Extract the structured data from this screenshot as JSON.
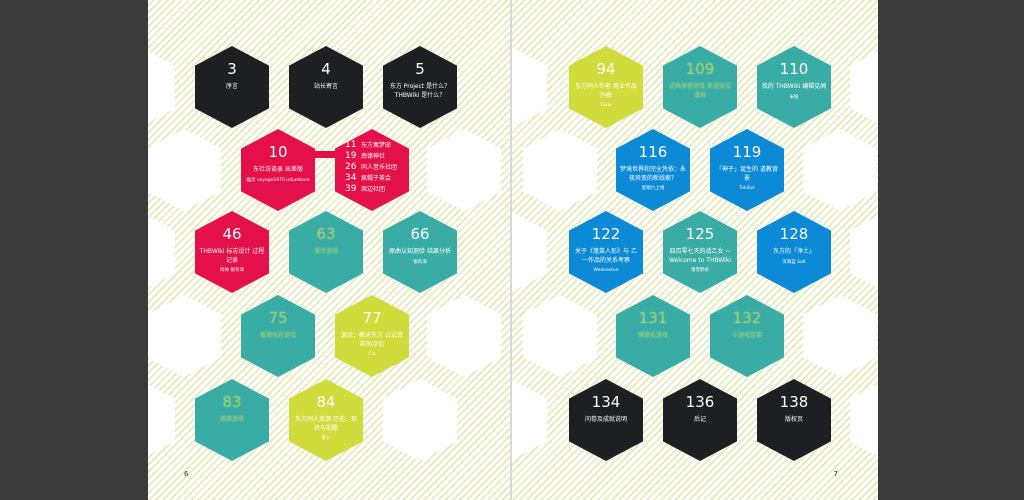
{
  "colors": {
    "black": "#1e1f22",
    "red": "#e4104a",
    "teal": "#3aaca6",
    "lime": "#cfdc3c",
    "blue": "#0c8ad6"
  },
  "left_page": {
    "page_number": "6",
    "entries": [
      {
        "num": "3",
        "title": "序言",
        "author": "",
        "color": "black"
      },
      {
        "num": "4",
        "title": "站长寄言",
        "author": "",
        "color": "black"
      },
      {
        "num": "5",
        "title": "东方 Project 是什么？ THBWiki 是什么？",
        "author": "",
        "color": "black"
      },
      {
        "num": "10",
        "title": "东社访谈录 出差版",
        "author": "幽灵 voyage1970 udumbara",
        "color": "red"
      },
      {
        "num": "46",
        "title": "THBWiki 标志设计 过程记录",
        "author": "阿帅 银有海",
        "color": "red"
      },
      {
        "num": "63",
        "title": "漫评游戏",
        "author": "",
        "color": "teal",
        "blur": true
      },
      {
        "num": "66",
        "title": "原曲认知测验 结果分析",
        "author": "银有海",
        "color": "teal"
      },
      {
        "num": "75",
        "title": "看图找茬游戏",
        "author": "",
        "color": "teal",
        "blur": true
      },
      {
        "num": "77",
        "title": "源流：概述东方 公式资料的汉化",
        "author": "Cio",
        "color": "lime"
      },
      {
        "num": "83",
        "title": "猜猜游戏",
        "author": "",
        "color": "teal",
        "blur": true
      },
      {
        "num": "84",
        "title": "东方同人资源 历史、现状与前瞻",
        "author": "萝卜",
        "color": "lime"
      }
    ],
    "sub_entries": [
      {
        "num": "11",
        "title": "东方寓梦邸"
      },
      {
        "num": "19",
        "title": "南德神社"
      },
      {
        "num": "26",
        "title": "同人音乐社团"
      },
      {
        "num": "34",
        "title": "疯帽子茶会"
      },
      {
        "num": "39",
        "title": "周边社团"
      }
    ]
  },
  "right_page": {
    "page_number": "7",
    "entries": [
      {
        "num": "94",
        "title": "东方同人作者 商业作品列表",
        "author": "Tokai",
        "color": "lime"
      },
      {
        "num": "109",
        "title": "近两身感游戏 新语常见漫画",
        "author": "",
        "color": "teal",
        "blur": true
      },
      {
        "num": "110",
        "title": "我的 THBWiki 编辑见闻",
        "author": "米娅",
        "color": "teal"
      },
      {
        "num": "116",
        "title": "梦境世界和完全凭依：永夜异变的新线索？",
        "author": "星期六上线",
        "color": "blue"
      },
      {
        "num": "119",
        "title": "「神子」诞生的 道教背景",
        "author": "Tokibei",
        "color": "blue"
      },
      {
        "num": "122",
        "title": "关于《蓬莱人形》与 乙一作品的关系考察",
        "author": "Wedneston",
        "color": "blue"
      },
      {
        "num": "125",
        "title": "四百零七天的战乙女 ~ Welcome to THBWiki",
        "author": "落雪鸦杀",
        "color": "teal"
      },
      {
        "num": "128",
        "title": "东方的「净土」",
        "author": "深海蓝 Salt",
        "color": "blue"
      },
      {
        "num": "131",
        "title": "猜歌名游戏",
        "author": "",
        "color": "teal",
        "blur": true
      },
      {
        "num": "132",
        "title": "小游戏答案",
        "author": "",
        "color": "teal",
        "blur": true
      },
      {
        "num": "134",
        "title": "问卷及成就说明",
        "author": "",
        "color": "black"
      },
      {
        "num": "136",
        "title": "后记",
        "author": "",
        "color": "black"
      },
      {
        "num": "138",
        "title": "版权页",
        "author": "",
        "color": "black"
      }
    ]
  }
}
